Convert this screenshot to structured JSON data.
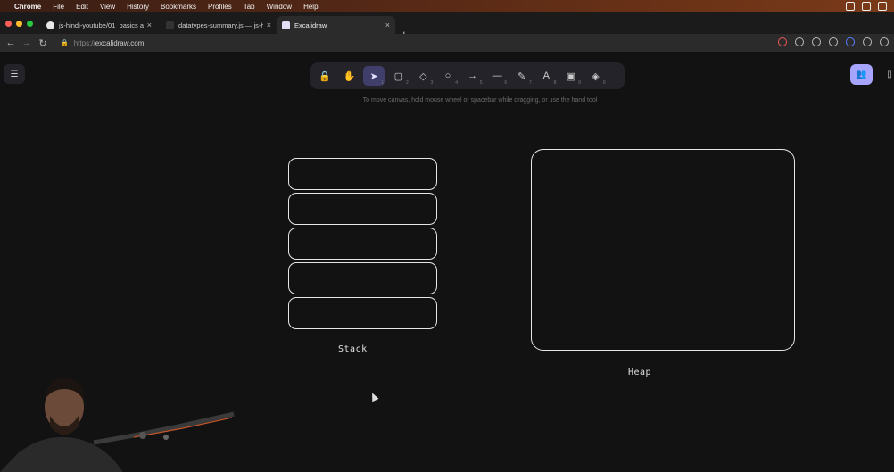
{
  "menubar": {
    "items": [
      "Chrome",
      "File",
      "Edit",
      "View",
      "History",
      "Bookmarks",
      "Profiles",
      "Tab",
      "Window",
      "Help"
    ]
  },
  "tabs": [
    {
      "label": "js-hindi-youtube/01_basics at",
      "icon": "github-icon"
    },
    {
      "label": "datatypes-summary.js — js-hi",
      "icon": "vscode-icon"
    },
    {
      "label": "Excalidraw",
      "icon": "excalidraw-icon"
    }
  ],
  "address": {
    "scheme": "https://",
    "host": "excalidraw.com"
  },
  "toolbar": {
    "tools": [
      {
        "name": "lock",
        "glyph": "🔒",
        "num": ""
      },
      {
        "name": "hand",
        "glyph": "✋",
        "num": ""
      },
      {
        "name": "selection",
        "glyph": "➤",
        "num": "1",
        "active": true
      },
      {
        "name": "rectangle",
        "glyph": "▢",
        "num": "2"
      },
      {
        "name": "diamond",
        "glyph": "◇",
        "num": "3"
      },
      {
        "name": "ellipse",
        "glyph": "○",
        "num": "4"
      },
      {
        "name": "arrow",
        "glyph": "→",
        "num": "5"
      },
      {
        "name": "line",
        "glyph": "—",
        "num": "6"
      },
      {
        "name": "draw",
        "glyph": "✎",
        "num": "7"
      },
      {
        "name": "text",
        "glyph": "A",
        "num": "8"
      },
      {
        "name": "image",
        "glyph": "▣",
        "num": "9"
      },
      {
        "name": "eraser",
        "glyph": "◈",
        "num": "0"
      }
    ]
  },
  "canvas": {
    "hint": "To move canvas, hold mouse wheel or spacebar while dragging, or use the hand tool",
    "stack_label": "Stack",
    "heap_label": "Heap"
  },
  "colors": {
    "accent": "#a8a5ff",
    "active_tool_bg": "#403e6a",
    "canvas_bg": "#121212",
    "stroke": "#e6e6e6"
  }
}
